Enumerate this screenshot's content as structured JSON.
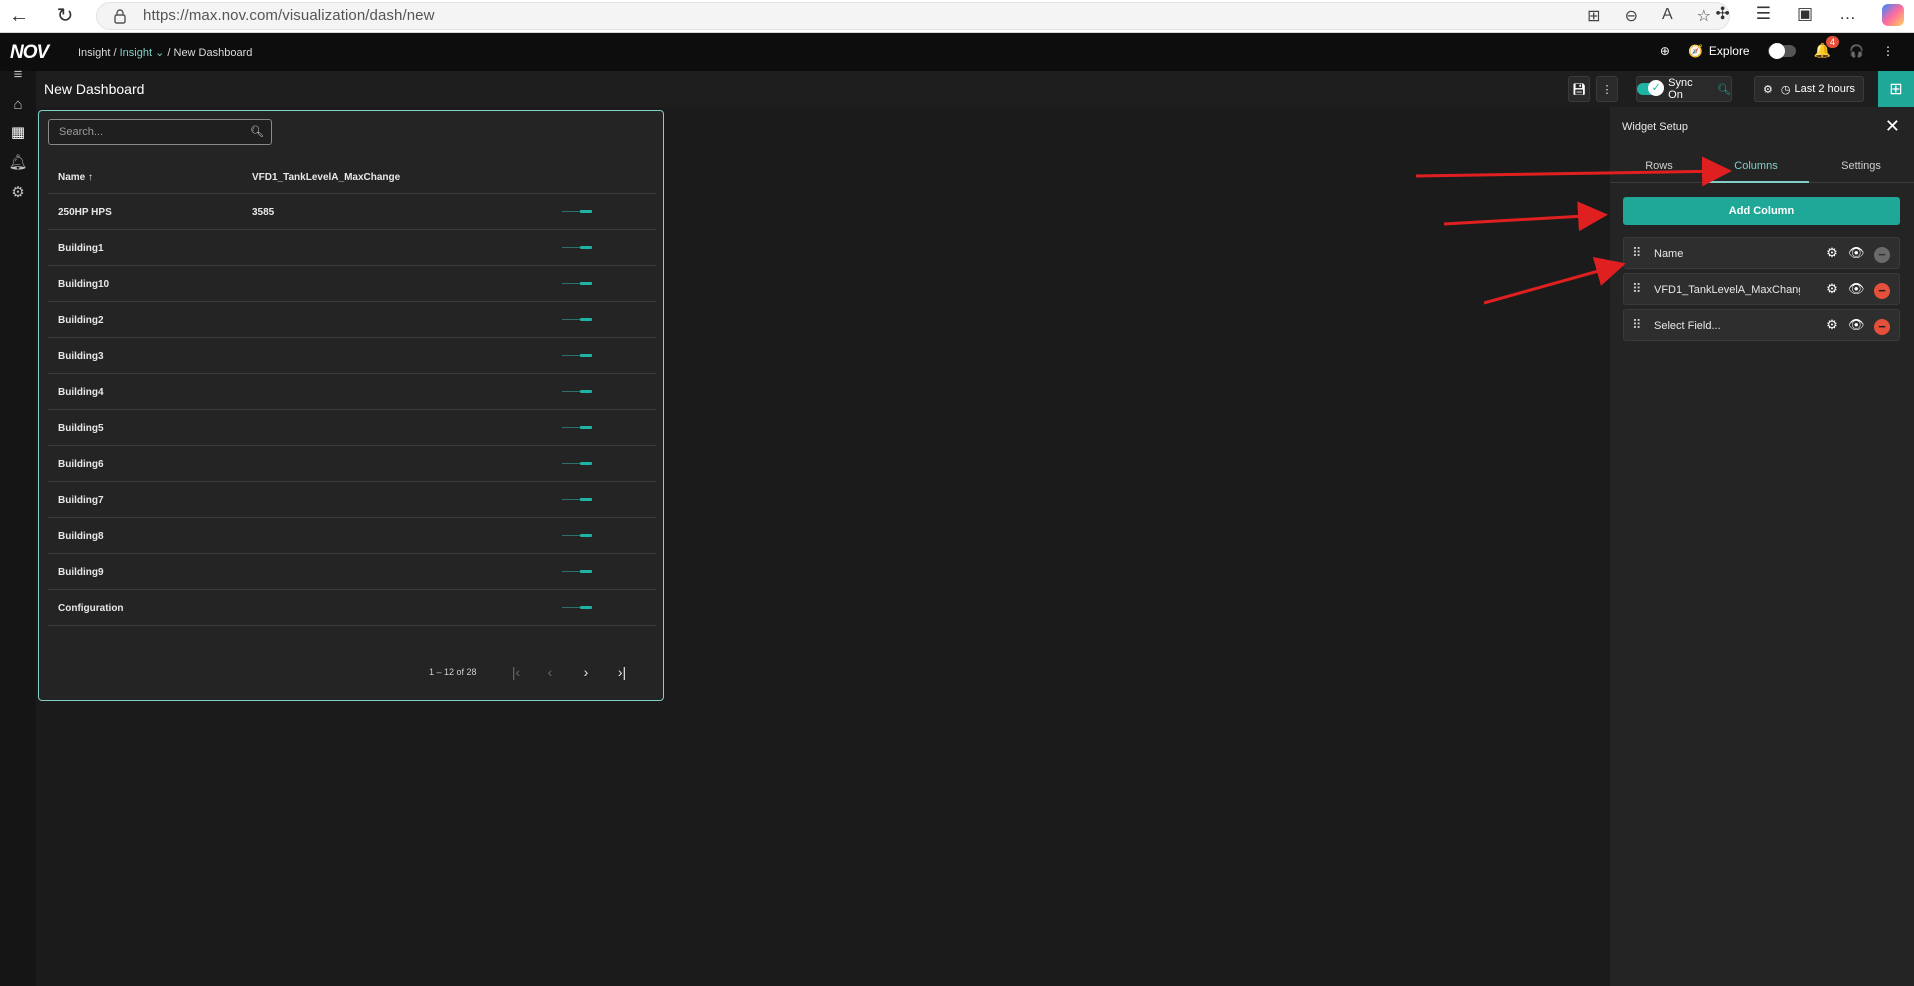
{
  "browser": {
    "url": "https://max.nov.com/visualization/dash/new"
  },
  "header": {
    "logo": "NOV",
    "breadcrumb": {
      "root": "Insight",
      "sep1": "/",
      "current_app": "Insight",
      "sep2": "/",
      "page": "New Dashboard"
    },
    "explore_label": "Explore",
    "notification_count": "4"
  },
  "toolbar": {
    "title": "New Dashboard",
    "sync_label": "Sync On",
    "time_range": "Last 2 hours"
  },
  "widget": {
    "search_placeholder": "Search...",
    "columns": [
      "Name",
      "VFD1_TankLevelA_MaxChange"
    ],
    "sort_indicator": "↑",
    "rows": [
      {
        "name": "250HP HPS",
        "value": "3585"
      },
      {
        "name": "Building1",
        "value": ""
      },
      {
        "name": "Building10",
        "value": ""
      },
      {
        "name": "Building2",
        "value": ""
      },
      {
        "name": "Building3",
        "value": ""
      },
      {
        "name": "Building4",
        "value": ""
      },
      {
        "name": "Building5",
        "value": ""
      },
      {
        "name": "Building6",
        "value": ""
      },
      {
        "name": "Building7",
        "value": ""
      },
      {
        "name": "Building8",
        "value": ""
      },
      {
        "name": "Building9",
        "value": ""
      },
      {
        "name": "Configuration",
        "value": ""
      }
    ],
    "pagination": "1 – 12 of 28"
  },
  "panel": {
    "title": "Widget Setup",
    "tabs": [
      "Rows",
      "Columns",
      "Settings"
    ],
    "active_tab": "Columns",
    "add_column_label": "Add Column",
    "column_items": [
      {
        "label": "Name",
        "removable": false
      },
      {
        "label": "VFD1_TankLevelA_MaxChange",
        "removable": true
      },
      {
        "label": "Select Field...",
        "removable": true
      }
    ]
  },
  "colors": {
    "accent": "#1fa798",
    "accent_light": "#7fd1c8",
    "danger": "#e5503a",
    "annotation_arrow": "#e02020"
  }
}
